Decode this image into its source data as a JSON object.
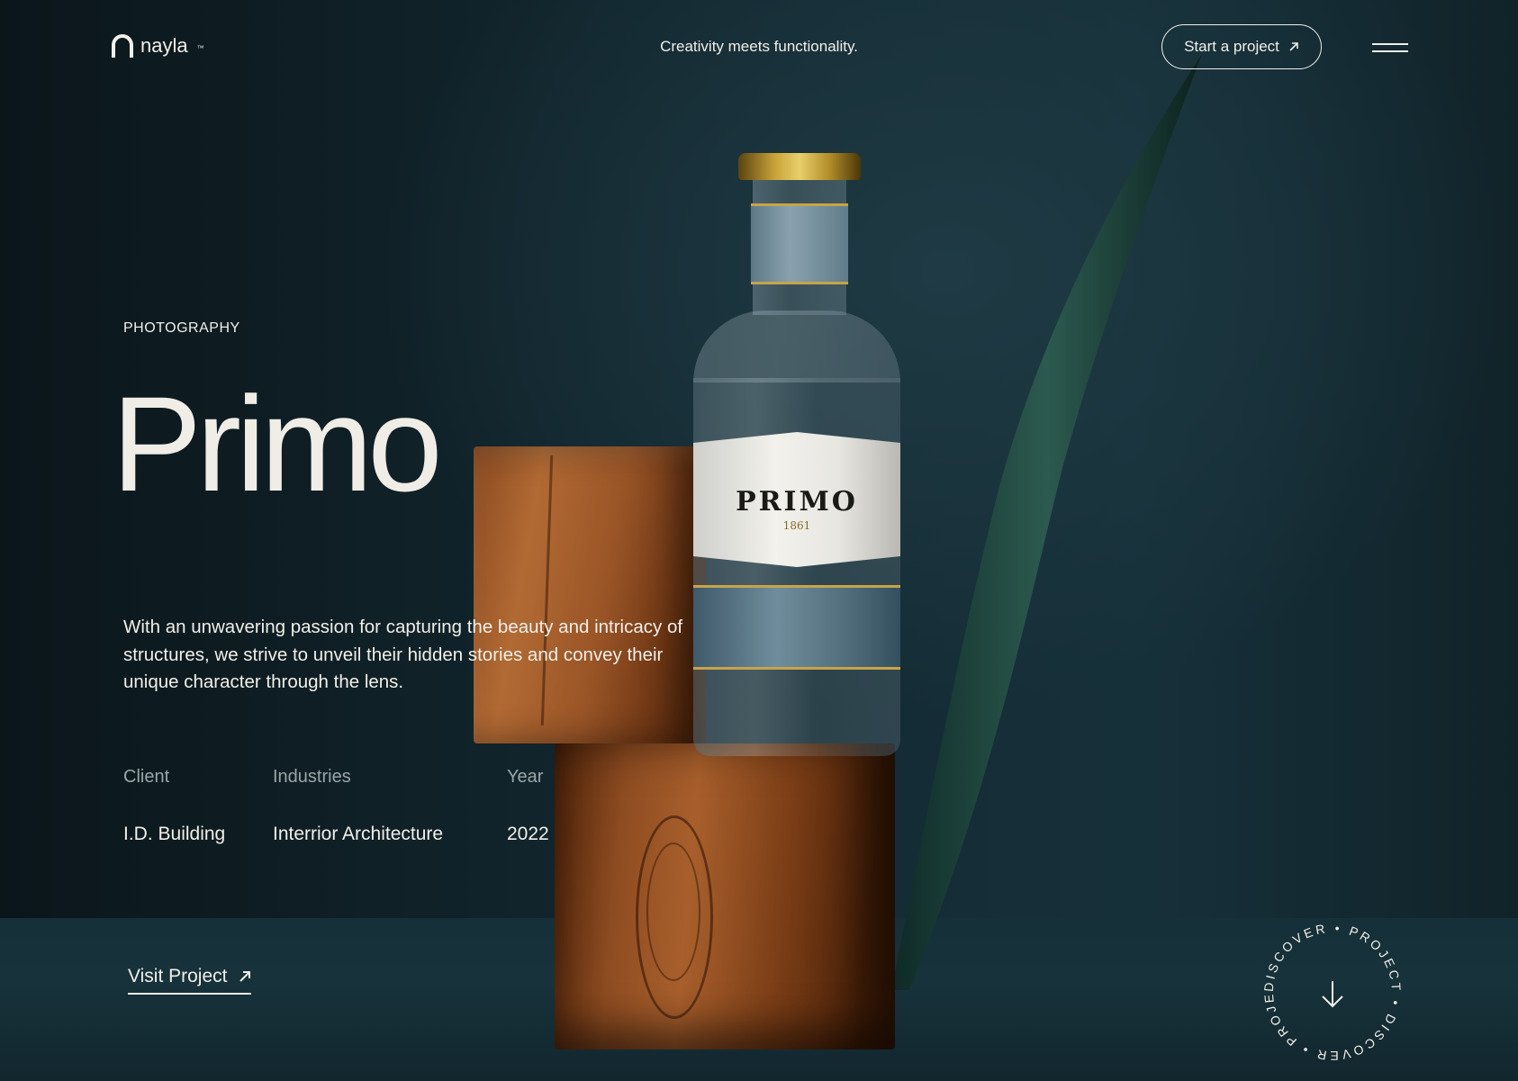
{
  "header": {
    "logo_text": "nayla",
    "logo_tm": "™",
    "tagline": "Creativity meets functionality.",
    "cta_label": "Start a project",
    "cta_icon": "arrow-up-right-icon",
    "menu_icon": "hamburger-menu-icon"
  },
  "hero": {
    "category": "PHOTOGRAPHY",
    "title": "Primo",
    "description": "With an unwavering passion for capturing the beauty and intricacy of structures, we strive to unveil their hidden stories and convey their unique character through the lens."
  },
  "details": {
    "client_label": "Client",
    "client_value": "I.D. Building",
    "industries_label": "Industries",
    "industries_value": "Interrior Architecture",
    "year_label": "Year",
    "year_value": "2022"
  },
  "visit_label": "Visit Project",
  "discover": {
    "ring_text": "DISCOVER • PROJECT • DISCOVER • PROJECT • ",
    "icon": "arrow-down-icon"
  },
  "bottle": {
    "brand": "PRIMO",
    "year": "1861"
  },
  "colors": {
    "background": "#132830",
    "text": "#f1efe9",
    "muted": "#9aa6a8"
  }
}
